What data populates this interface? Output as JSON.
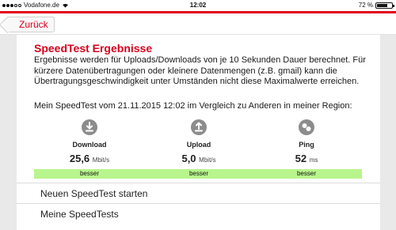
{
  "status_bar": {
    "carrier": "Vodafone.de",
    "time": "12:02",
    "battery": "72 %",
    "battery_level": 0.72
  },
  "nav": {
    "back_label": "Zurück"
  },
  "page": {
    "title": "SpeedTest Ergebnisse",
    "description": "Ergebnisse werden für Uploads/Downloads von je 10 Sekunden Dauer berechnet. Für kürzere Datenübertragungen oder kleinere Datenmengen (z.B. gmail) kann die Übertragungsgeschwindigkeit unter Umständen nicht diese Maximalwerte erreichen.",
    "comparison": "Mein SpeedTest vom 21.11.2015 12:02 im Vergleich zu Anderen in meiner Region:"
  },
  "metrics": [
    {
      "label": "Download",
      "value": "25,6",
      "unit": "Mbit/s",
      "badge": "besser",
      "icon": "download-icon"
    },
    {
      "label": "Upload",
      "value": "5,0",
      "unit": "Mbit/s",
      "badge": "besser",
      "icon": "upload-icon"
    },
    {
      "label": "Ping",
      "value": "52",
      "unit": "ms",
      "badge": "besser",
      "icon": "ping-icon"
    }
  ],
  "actions": [
    {
      "label": "Neuen SpeedTest starten"
    },
    {
      "label": "Meine SpeedTests"
    }
  ],
  "colors": {
    "accent": "#d6001c",
    "badge": "#b8f58c",
    "icon": "#8c8c8c"
  }
}
